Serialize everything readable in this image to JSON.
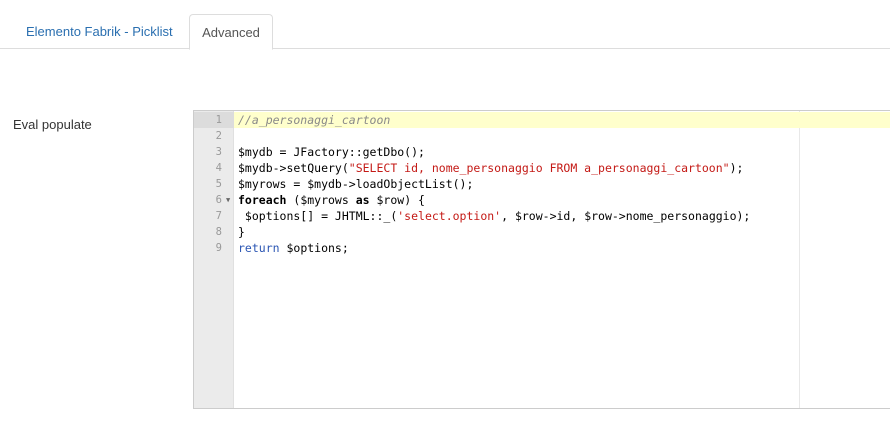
{
  "tabs": [
    {
      "label": "Elemento Fabrik - Picklist"
    },
    {
      "label": "Advanced"
    }
  ],
  "field": {
    "label": "Eval populate"
  },
  "editor": {
    "lines": [
      {
        "number": "1",
        "parts": [
          {
            "text": "//a_personaggi_cartoon",
            "kind": "comment"
          }
        ]
      },
      {
        "number": "2",
        "parts": []
      },
      {
        "number": "3",
        "parts": [
          {
            "text": "$mydb = JFactory::getDbo();",
            "kind": "plain"
          }
        ]
      },
      {
        "number": "4",
        "parts": [
          {
            "text": "$mydb->setQuery(",
            "kind": "plain"
          },
          {
            "text": "\"SELECT id, nome_personaggio FROM a_personaggi_cartoon\"",
            "kind": "str"
          },
          {
            "text": ");",
            "kind": "plain"
          }
        ]
      },
      {
        "number": "5",
        "parts": [
          {
            "text": "$myrows = $mydb->loadObjectList();",
            "kind": "plain"
          }
        ]
      },
      {
        "number": "6",
        "parts": [
          {
            "text": "foreach",
            "kind": "kw"
          },
          {
            "text": " ($myrows ",
            "kind": "plain"
          },
          {
            "text": "as",
            "kind": "kw"
          },
          {
            "text": " $row) {",
            "kind": "plain"
          }
        ]
      },
      {
        "number": "7",
        "parts": [
          {
            "text": " $options[] = JHTML::_(",
            "kind": "plain"
          },
          {
            "text": "'select.option'",
            "kind": "str"
          },
          {
            "text": ", $row->id, $row->nome_personaggio);",
            "kind": "plain"
          }
        ]
      },
      {
        "number": "8",
        "parts": [
          {
            "text": "}",
            "kind": "plain"
          }
        ]
      },
      {
        "number": "9",
        "parts": [
          {
            "text": "return",
            "kind": "blue"
          },
          {
            "text": " $options;",
            "kind": "plain"
          }
        ]
      }
    ]
  }
}
